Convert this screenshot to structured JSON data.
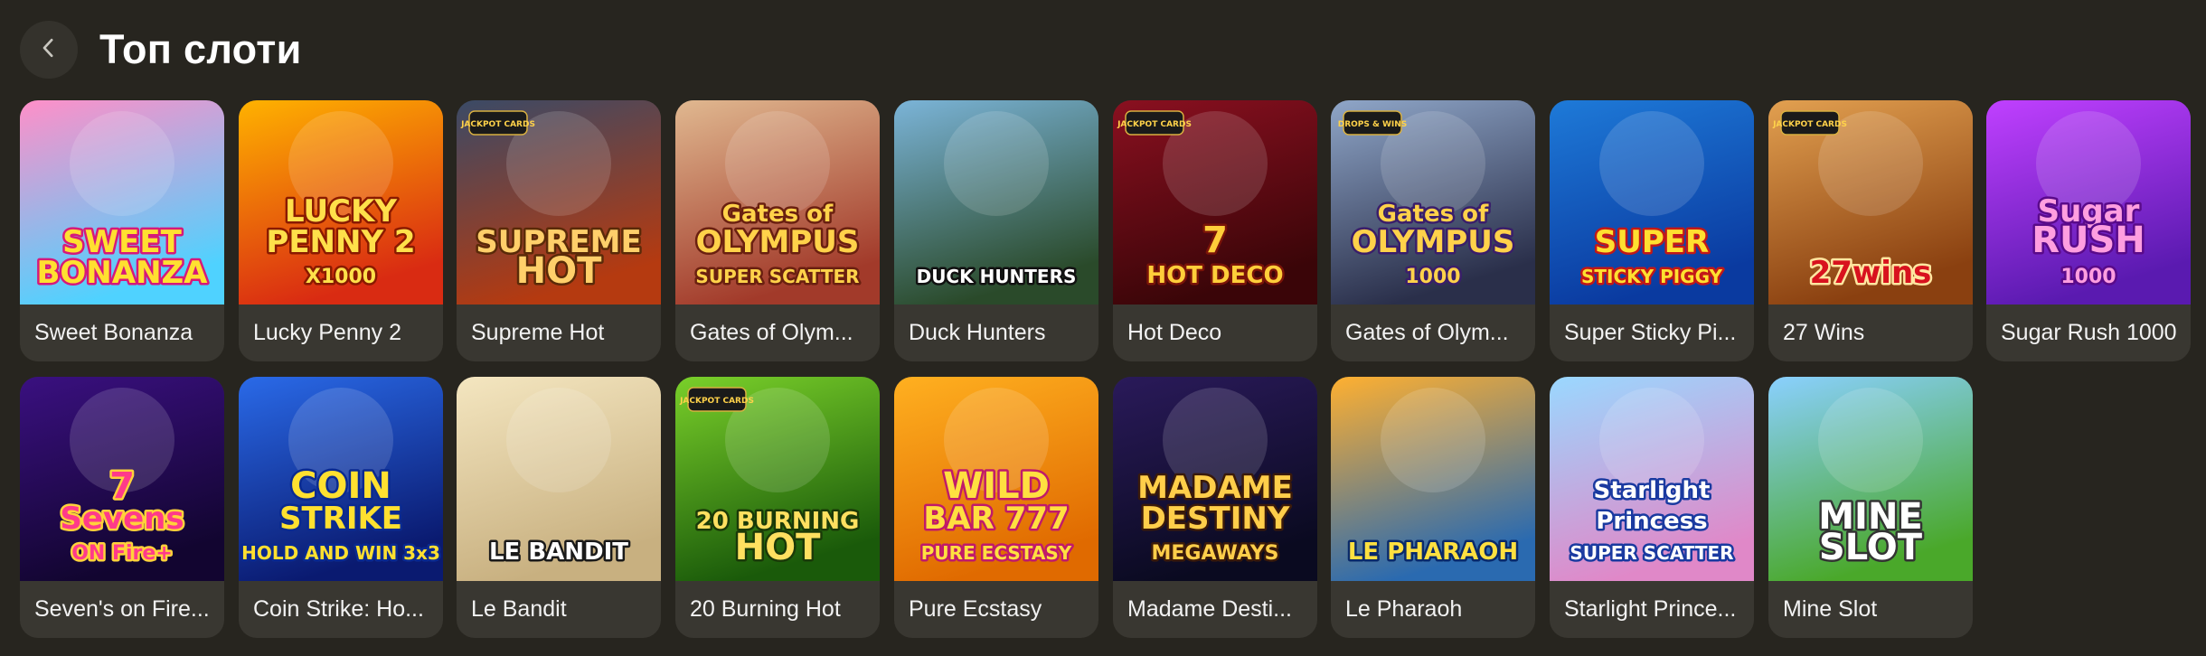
{
  "header": {
    "back_icon": "chevron-left-icon",
    "title": "Топ слоти"
  },
  "games": [
    {
      "id": "sweet-bonanza",
      "label": "Sweet Bonanza",
      "art": [
        "SWEET",
        "BONANZA"
      ],
      "bg": [
        "#ff8fc8",
        "#4fd2ff"
      ],
      "fg": "#ffe030",
      "stroke": "#d6197a"
    },
    {
      "id": "lucky-penny-2",
      "label": "Lucky Penny 2",
      "art": [
        "LUCKY",
        "PENNY 2",
        "X1000"
      ],
      "bg": [
        "#ffb200",
        "#d92b12"
      ],
      "fg": "#ffe04a",
      "stroke": "#8a1a00"
    },
    {
      "id": "supreme-hot",
      "label": "Supreme Hot",
      "badge": "JACKPOT CARDS",
      "art": [
        "SUPREME",
        "HOT"
      ],
      "bg": [
        "#3a4a66",
        "#b53a10"
      ],
      "fg": "#ffcf6a",
      "stroke": "#5a2a08"
    },
    {
      "id": "gates-of-olympus-super-scatter",
      "label": "Gates of Olym...",
      "art": [
        "Gates of",
        "OLYMPUS",
        "SUPER SCATTER"
      ],
      "bg": [
        "#e0b890",
        "#a23a2a"
      ],
      "fg": "#ffd24a",
      "stroke": "#6a2010"
    },
    {
      "id": "duck-hunters",
      "label": "Duck Hunters",
      "art": [
        "DUCK HUNTERS"
      ],
      "bg": [
        "#7bb4d8",
        "#2a4a2a"
      ],
      "fg": "#ffffff",
      "stroke": "#111111"
    },
    {
      "id": "hot-deco",
      "label": "Hot Deco",
      "badge": "JACKPOT CARDS",
      "art": [
        "7",
        "HOT DECO"
      ],
      "bg": [
        "#8a1020",
        "#3a0508"
      ],
      "fg": "#ffce3a",
      "stroke": "#7a1408"
    },
    {
      "id": "gates-of-olympus-1000",
      "label": "Gates of Olym...",
      "badge": "DROPS & WINS",
      "art": [
        "Gates of",
        "OLYMPUS",
        "1000"
      ],
      "bg": [
        "#8fa6c8",
        "#2a2f4a"
      ],
      "fg": "#ffd24a",
      "stroke": "#3a1e6a"
    },
    {
      "id": "super-sticky-piggy",
      "label": "Super Sticky Pi...",
      "art": [
        "SUPER",
        "STICKY PIGGY"
      ],
      "bg": [
        "#1e7ad8",
        "#0a3aa0"
      ],
      "fg": "#ffe030",
      "stroke": "#c21818"
    },
    {
      "id": "27-wins",
      "label": "27 Wins",
      "badge": "JACKPOT CARDS",
      "art": [
        "27wins"
      ],
      "bg": [
        "#e2a050",
        "#8a4010"
      ],
      "fg": "#d8121e",
      "stroke": "#ffe6a0"
    },
    {
      "id": "sugar-rush-1000",
      "label": "Sugar Rush 1000",
      "art": [
        "Sugar",
        "RUSH",
        "1000"
      ],
      "bg": [
        "#c040ff",
        "#5a1ab0"
      ],
      "fg": "#ff9ee0",
      "stroke": "#5a0a8a"
    },
    {
      "id": "sevens-on-fire",
      "label": "Seven's on Fire...",
      "art": [
        "7",
        "Sevens",
        "ON Fire+"
      ],
      "bg": [
        "#3a1080",
        "#120530"
      ],
      "fg": "#ff3a8a",
      "stroke": "#ffd23a"
    },
    {
      "id": "coin-strike",
      "label": "Coin Strike: Ho...",
      "art": [
        "COIN",
        "STRIKE",
        "HOLD AND WIN 3x3"
      ],
      "bg": [
        "#2a6ae8",
        "#0a1a70"
      ],
      "fg": "#ffe030",
      "stroke": "#0a2a90"
    },
    {
      "id": "le-bandit",
      "label": "Le Bandit",
      "art": [
        "LE BANDIT"
      ],
      "bg": [
        "#f4e6c0",
        "#c8b080"
      ],
      "fg": "#ffffff",
      "stroke": "#1a1a1a"
    },
    {
      "id": "20-burning-hot",
      "label": "20 Burning Hot",
      "badge": "JACKPOT CARDS",
      "art": [
        "20 BURNING",
        "HOT"
      ],
      "bg": [
        "#7ad02a",
        "#1a5a0a"
      ],
      "fg": "#ffe060",
      "stroke": "#1a3a08"
    },
    {
      "id": "pure-ecstasy",
      "label": "Pure Ecstasy",
      "art": [
        "WILD",
        "BAR 777",
        "PURE ECSTASY"
      ],
      "bg": [
        "#ffb020",
        "#e06a00"
      ],
      "fg": "#ffe040",
      "stroke": "#c01a6a"
    },
    {
      "id": "madame-destiny-megaways",
      "label": "Madame Desti...",
      "art": [
        "MADAME",
        "DESTINY",
        "MEGAWAYS"
      ],
      "bg": [
        "#2a1a5a",
        "#0a0a20"
      ],
      "fg": "#ffce4a",
      "stroke": "#3a1a0a"
    },
    {
      "id": "le-pharaoh",
      "label": "Le Pharaoh",
      "art": [
        "LE PHARAOH"
      ],
      "bg": [
        "#ffb030",
        "#2a6ab0"
      ],
      "fg": "#ffe040",
      "stroke": "#0a2a6a"
    },
    {
      "id": "starlight-princess-super-scatter",
      "label": "Starlight Prince...",
      "art": [
        "Starlight",
        "Princess",
        "SUPER SCATTER"
      ],
      "bg": [
        "#9ad8ff",
        "#e088c8"
      ],
      "fg": "#ffffff",
      "stroke": "#1a3aa0"
    },
    {
      "id": "mine-slot",
      "label": "Mine Slot",
      "art": [
        "MINE",
        "SLOT"
      ],
      "bg": [
        "#8ad0ff",
        "#4aa82a"
      ],
      "fg": "#ffffff",
      "stroke": "#333333"
    }
  ]
}
